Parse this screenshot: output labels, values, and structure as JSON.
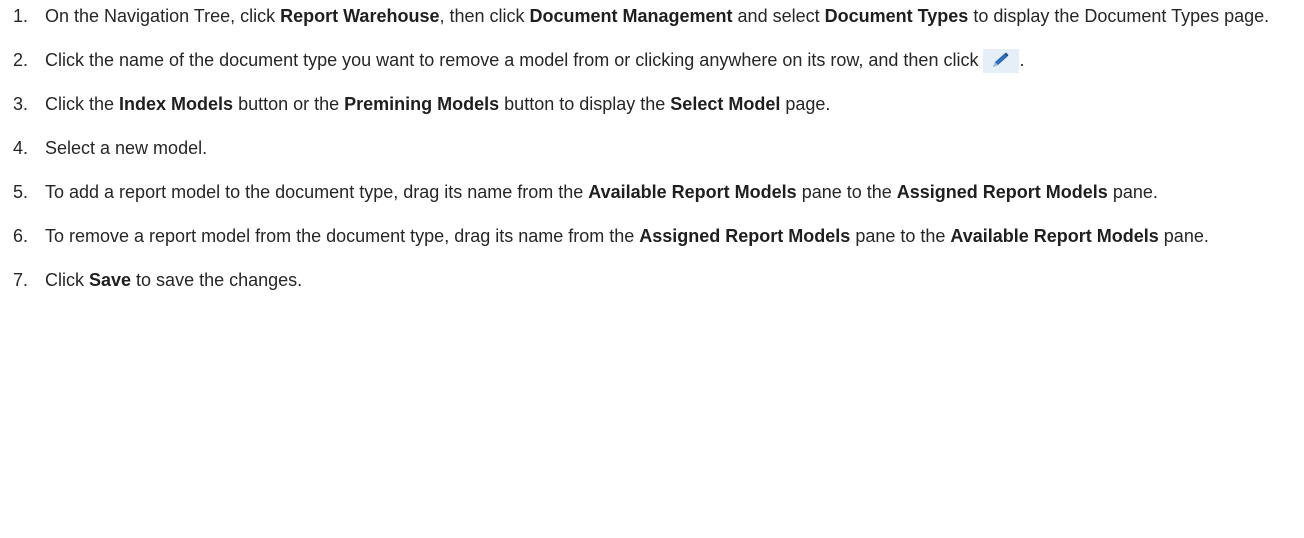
{
  "steps": [
    {
      "num": "1.",
      "t1": "On the Navigation Tree, click ",
      "b1": "Report Warehouse",
      "t2": ", then click ",
      "b2": "Document Management",
      "t3": " and select ",
      "b3": "Document Types",
      "t4": " to display the Document Types page."
    },
    {
      "num": "2.",
      "t1": "Click the name of the document type you want to remove a model from or clicking anywhere on its row, and then click",
      "icon": "edit-pencil-icon",
      "t2": "."
    },
    {
      "num": "3.",
      "t1": "Click the ",
      "b1": "Index Models",
      "t2": " button or the ",
      "b2": "Premining Models",
      "t3": " button to display the ",
      "b3": "Select Model",
      "t4": " page."
    },
    {
      "num": "4.",
      "t1": "Select a new model."
    },
    {
      "num": "5.",
      "t1": "To add a report model to the document type, drag its name from the ",
      "b1": "Available Report Models",
      "t2": " pane to the ",
      "b2": "Assigned Report Models",
      "t3": " pane."
    },
    {
      "num": "6.",
      "t1": "To remove a report model from the document type, drag its name from the ",
      "b1": "Assigned Report Models",
      "t2": " pane to the ",
      "b2": "Available Report Models",
      "t3": " pane."
    },
    {
      "num": "7.",
      "t1": "Click ",
      "b1": "Save",
      "t2": " to save the changes."
    }
  ],
  "colors": {
    "text": "#262626",
    "icon_bg": "#e6eef7",
    "icon_pencil": "#2f6db5"
  }
}
